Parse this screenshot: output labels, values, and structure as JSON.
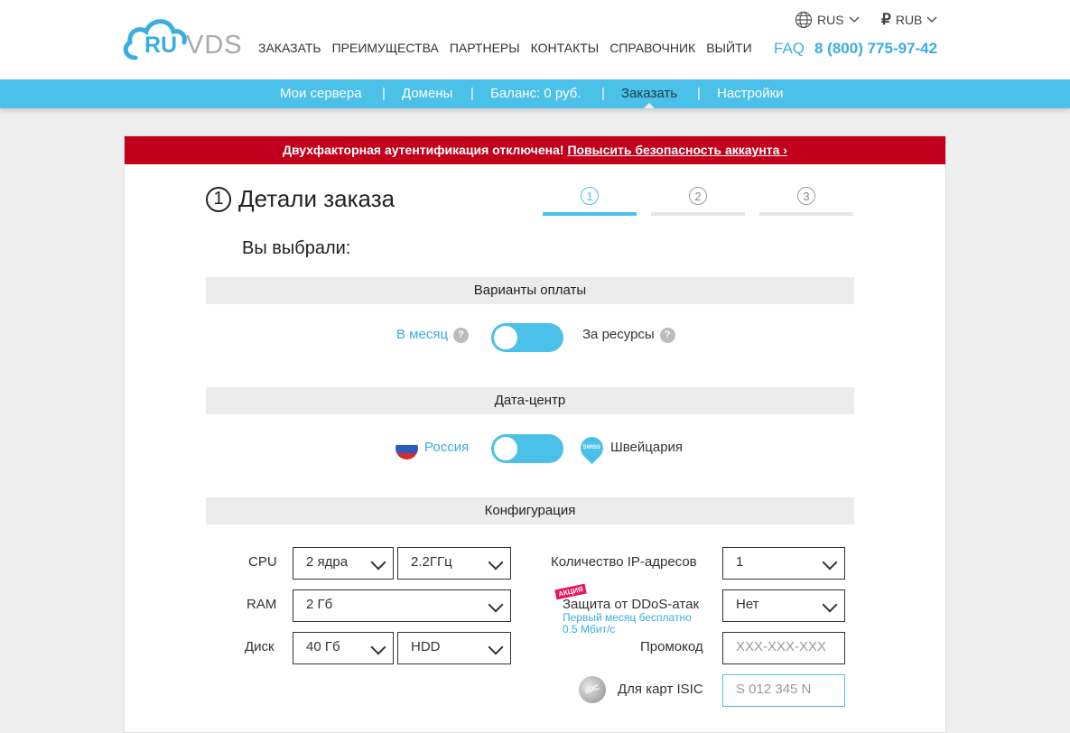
{
  "logo": {
    "ru": "RU",
    "vds": "VDS"
  },
  "main_nav": [
    "ЗАКАЗАТЬ",
    "ПРЕИМУЩЕСТВА",
    "ПАРТНЕРЫ",
    "КОНТАКТЫ",
    "СПРАВОЧНИК",
    "ВЫЙТИ"
  ],
  "header": {
    "language": "RUS",
    "currency_symbol": "₽",
    "currency": "RUB",
    "faq": "FAQ",
    "phone": "8 (800) 775-97-42"
  },
  "sub_nav": {
    "items": [
      "Мои сервера",
      "Домены",
      "Баланс: 0 руб.",
      "Заказать",
      "Настройки"
    ],
    "separator": "|",
    "active": "Заказать"
  },
  "alert": {
    "text": "Двухфакторная аутентификация отключена! ",
    "link": "Повысить безопасность аккаунта ›"
  },
  "step": {
    "number": "1",
    "title": "Детали заказа",
    "steps": [
      "1",
      "2",
      "3"
    ],
    "active_step": 1
  },
  "chosen_label": "Вы выбрали:",
  "payment": {
    "header": "Варианты оплаты",
    "left": "В месяц",
    "right": "За ресурсы",
    "help": "?"
  },
  "datacenter": {
    "header": "Дата-центр",
    "left": "Россия",
    "right": "Швейцария",
    "swiss_badge": "SWISS"
  },
  "config": {
    "header": "Конфигурация",
    "cpu": {
      "label": "CPU",
      "cores": "2 ядра",
      "freq": "2.2ГГц"
    },
    "ram": {
      "label": "RAM",
      "value": "2 Гб"
    },
    "disk": {
      "label": "Диск",
      "size": "40 Гб",
      "type": "HDD"
    },
    "ip": {
      "label": "Количество IP-адресов",
      "value": "1"
    },
    "ddos": {
      "badge": "АКЦИЯ",
      "label": "Защита от DDoS-атак",
      "note1": "Первый месяц бесплатно",
      "note2": "0.5 Мбит/с",
      "value": "Нет"
    },
    "promo": {
      "label": "Промокод",
      "placeholder": "XXX-XXX-XXX"
    },
    "isic": {
      "badge": "ISIC",
      "label": "Для карт ISIC",
      "placeholder": "S 012 345 N"
    }
  },
  "colors": {
    "accent": "#4bc1ea",
    "alert": "#c3001c",
    "link": "#3aaee0"
  }
}
